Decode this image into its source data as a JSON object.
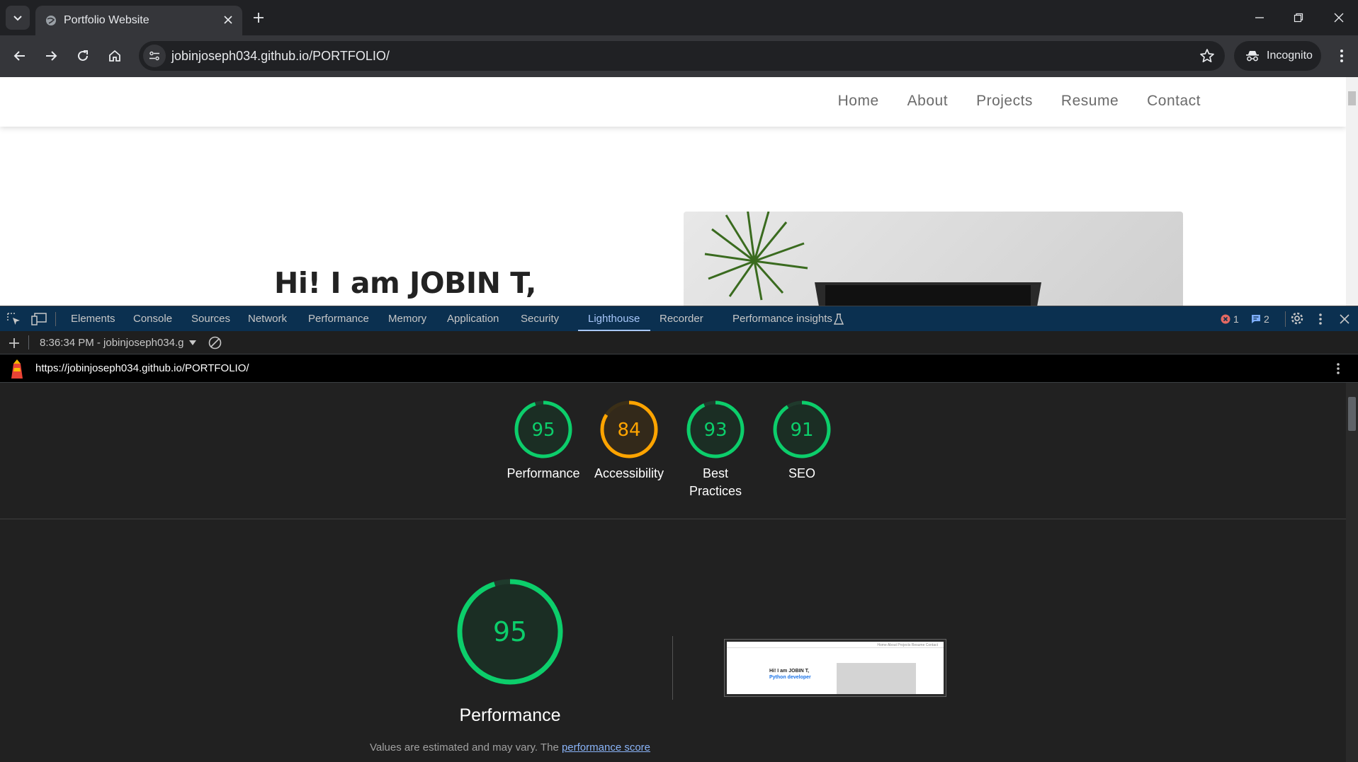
{
  "browser": {
    "tab_title": "Portfolio Website",
    "url_host": "jobinjoseph034.github.io",
    "url_path": "/PORTFOLIO/",
    "incognito_label": "Incognito"
  },
  "site": {
    "nav": [
      "Home",
      "About",
      "Projects",
      "Resume",
      "Contact"
    ],
    "hero_title": "Hi! I am JOBIN T,"
  },
  "devtools": {
    "tabs": [
      "Elements",
      "Console",
      "Sources",
      "Network",
      "Performance",
      "Memory",
      "Application",
      "Security",
      "Lighthouse",
      "Recorder",
      "Performance insights"
    ],
    "active_tab": "Lighthouse",
    "error_count": "1",
    "message_count": "2",
    "report_selector": "8:36:34 PM - jobinjoseph034.g",
    "report_url": "https://jobinjoseph034.github.io/PORTFOLIO/"
  },
  "lighthouse": {
    "scores": [
      {
        "label": "Performance",
        "value": 95,
        "color": "#0cce6b"
      },
      {
        "label": "Accessibility",
        "value": 84,
        "color": "#ffa400"
      },
      {
        "label": "Best Practices",
        "value": 93,
        "color": "#0cce6b"
      },
      {
        "label": "SEO",
        "value": 91,
        "color": "#0cce6b"
      }
    ],
    "main_score": 95,
    "main_label": "Performance",
    "note_prefix": "Values are estimated and may vary. The ",
    "note_link": "performance score"
  },
  "thumbnail": {
    "nav": "Home   About   Projects   Resume   Contact",
    "title": "Hi! I am JOBIN T,",
    "subtitle": "Python developer"
  }
}
